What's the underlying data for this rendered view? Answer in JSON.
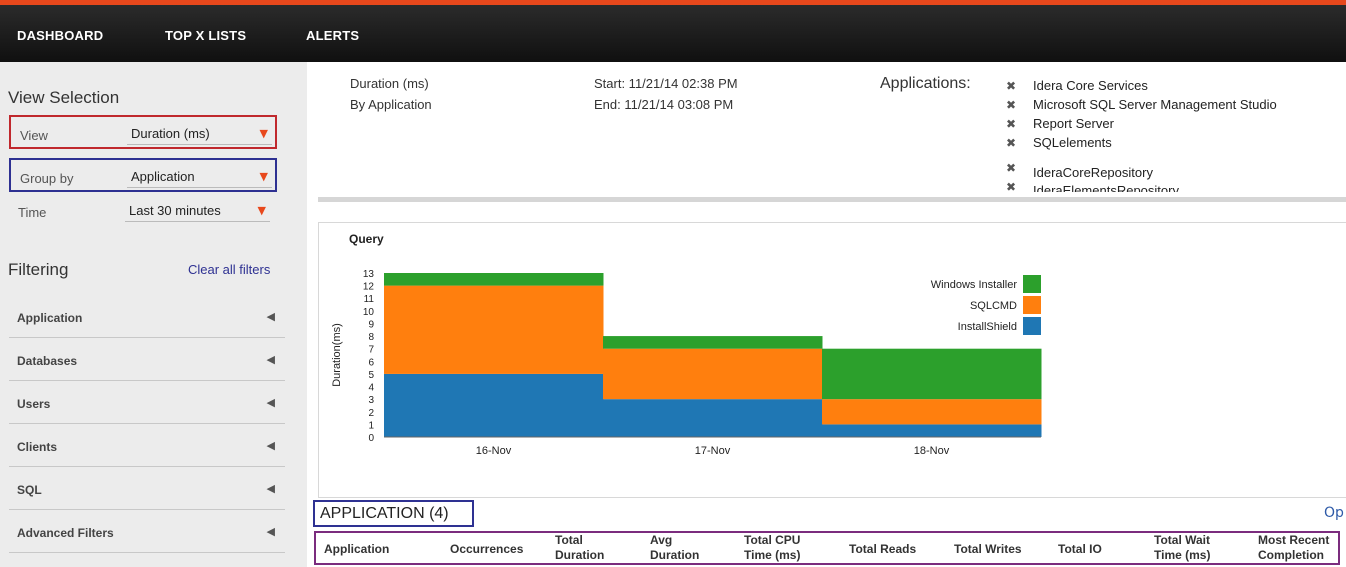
{
  "nav": {
    "items": [
      "DASHBOARD",
      "TOP X LISTS",
      "ALERTS"
    ],
    "accent": "#e8481c"
  },
  "sidebar": {
    "view_selection_title": "View Selection",
    "view": {
      "label": "View",
      "value": "Duration (ms)"
    },
    "group_by": {
      "label": "Group by",
      "value": "Application"
    },
    "time": {
      "label": "Time",
      "value": "Last 30 minutes"
    },
    "filtering_title": "Filtering",
    "clear_all": "Clear all filters",
    "filters": [
      "Application",
      "Databases",
      "Users",
      "Clients",
      "SQL",
      "Advanced Filters"
    ]
  },
  "header": {
    "metric": "Duration (ms)",
    "grouping": "By Application",
    "start": "Start: 11/21/14 02:38 PM",
    "end": "End: 11/21/14 03:08 PM",
    "applications_label": "Applications:",
    "applications": [
      "Idera Core Services",
      "Microsoft SQL Server Management Studio",
      "Report Server",
      "SQLelements",
      "IderaCoreRepository",
      "IderaElementsRepository"
    ]
  },
  "chart_data": {
    "type": "area",
    "title": "Query",
    "xlabel": "",
    "ylabel": "Duration(ms)",
    "categories": [
      "16-Nov",
      "17-Nov",
      "18-Nov"
    ],
    "ylim": [
      0,
      13
    ],
    "yticks": [
      0,
      1,
      2,
      3,
      4,
      5,
      6,
      7,
      8,
      9,
      10,
      11,
      12,
      13
    ],
    "stacked": true,
    "step": true,
    "legend": "right",
    "series": [
      {
        "name": "InstallShield",
        "color": "#1f77b4",
        "values": [
          5,
          3,
          1
        ]
      },
      {
        "name": "SQLCMD",
        "color": "#ff7f0e",
        "values": [
          7,
          4,
          2
        ]
      },
      {
        "name": "Windows Installer",
        "color": "#2ca02c",
        "values": [
          1,
          1,
          4
        ]
      }
    ]
  },
  "table": {
    "title": "APPLICATION (4)",
    "options_link": "Op",
    "columns": [
      "Application",
      "Occurrences",
      "Total Duration (ms)",
      "Avg Duration (ms)",
      "Total CPU Time (ms)",
      "Total Reads",
      "Total Writes",
      "Total IO",
      "Total Wait Time (ms)",
      "Most Recent Completion"
    ]
  }
}
